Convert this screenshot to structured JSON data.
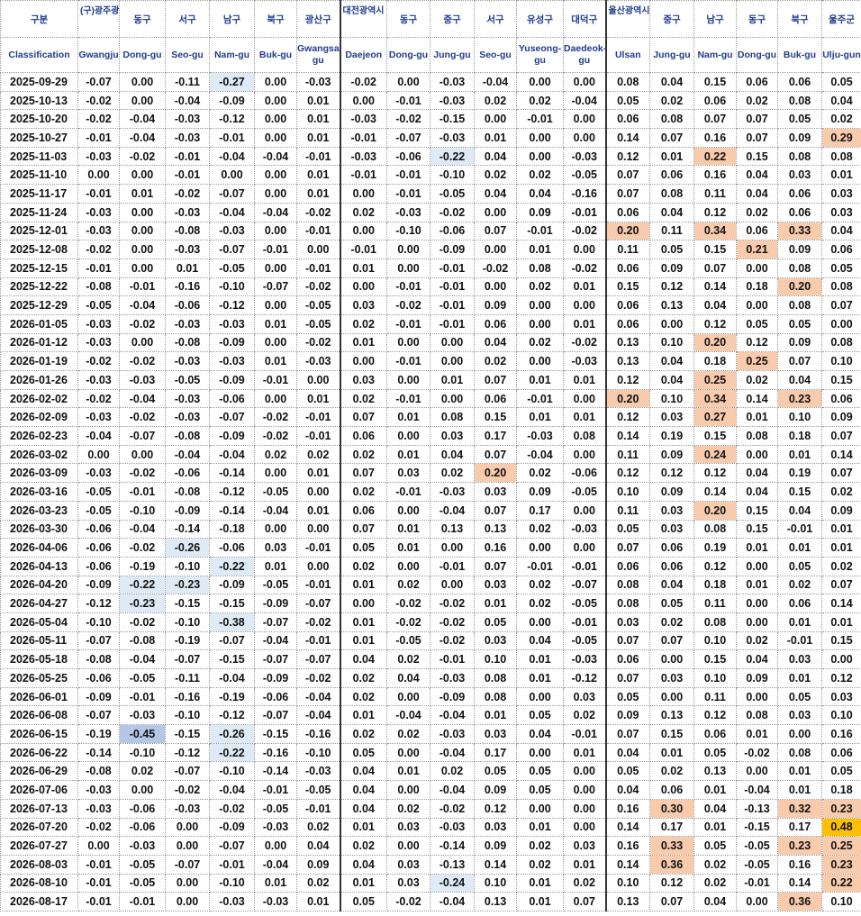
{
  "table": {
    "header_top": [
      "구분",
      "(구)광주광",
      "동구",
      "서구",
      "남구",
      "북구",
      "광산구",
      "대전광역시",
      "동구",
      "중구",
      "서구",
      "유성구",
      "대덕구",
      "울산광역시",
      "중구",
      "남구",
      "동구",
      "북구",
      "울주군"
    ],
    "header_bottom": [
      "Classification",
      "Gwangju",
      "Dong-gu",
      "Seo-gu",
      "Nam-gu",
      "Buk-gu",
      "Gwangsan-gu",
      "Daejeon",
      "Dong-gu",
      "Jung-gu",
      "Seo-gu",
      "Yuseong-gu",
      "Daedeok-gu",
      "Ulsan",
      "Jung-gu",
      "Nam-gu",
      "Dong-gu",
      "Buk-gu",
      "Ulju-gun"
    ],
    "rows": [
      {
        "date": "2025-09-29",
        "values": [
          "-0.07",
          "0.00",
          "-0.11",
          "-0.27",
          "0.00",
          "-0.03",
          "-0.02",
          "0.00",
          "-0.03",
          "-0.04",
          "0.00",
          "0.00",
          "0.08",
          "0.04",
          "0.15",
          "0.06",
          "0.06",
          "0.05"
        ]
      },
      {
        "date": "2025-10-13",
        "values": [
          "-0.02",
          "0.00",
          "-0.04",
          "-0.09",
          "0.00",
          "0.01",
          "0.00",
          "-0.01",
          "-0.03",
          "0.02",
          "0.02",
          "-0.04",
          "0.05",
          "0.02",
          "0.06",
          "0.02",
          "0.08",
          "0.04"
        ]
      },
      {
        "date": "2025-10-20",
        "values": [
          "-0.02",
          "-0.04",
          "-0.03",
          "-0.12",
          "0.00",
          "0.01",
          "-0.03",
          "-0.02",
          "-0.15",
          "0.00",
          "-0.01",
          "0.00",
          "0.06",
          "0.08",
          "0.07",
          "0.07",
          "0.05",
          "0.02"
        ]
      },
      {
        "date": "2025-10-27",
        "values": [
          "-0.01",
          "-0.04",
          "-0.03",
          "-0.01",
          "0.00",
          "0.01",
          "-0.01",
          "-0.07",
          "-0.03",
          "0.01",
          "0.00",
          "0.00",
          "0.14",
          "0.07",
          "0.16",
          "0.07",
          "0.09",
          "0.29"
        ]
      },
      {
        "date": "2025-11-03",
        "values": [
          "-0.03",
          "-0.02",
          "-0.01",
          "-0.04",
          "-0.04",
          "-0.01",
          "-0.03",
          "-0.06",
          "-0.22",
          "0.04",
          "0.00",
          "-0.03",
          "0.12",
          "0.01",
          "0.22",
          "0.15",
          "0.08",
          "0.08"
        ]
      },
      {
        "date": "2025-11-10",
        "values": [
          "0.00",
          "0.00",
          "-0.01",
          "0.00",
          "0.00",
          "0.01",
          "-0.01",
          "-0.01",
          "-0.10",
          "0.02",
          "0.02",
          "-0.05",
          "0.07",
          "0.06",
          "0.16",
          "0.04",
          "0.03",
          "0.01"
        ]
      },
      {
        "date": "2025-11-17",
        "values": [
          "-0.01",
          "0.01",
          "-0.02",
          "-0.07",
          "0.00",
          "0.01",
          "0.00",
          "-0.01",
          "-0.05",
          "0.04",
          "0.04",
          "-0.16",
          "0.07",
          "0.08",
          "0.11",
          "0.04",
          "0.06",
          "0.03"
        ]
      },
      {
        "date": "2025-11-24",
        "values": [
          "-0.03",
          "0.00",
          "-0.03",
          "-0.04",
          "-0.04",
          "-0.02",
          "0.02",
          "-0.03",
          "-0.02",
          "0.00",
          "0.09",
          "-0.01",
          "0.06",
          "0.04",
          "0.12",
          "0.02",
          "0.06",
          "0.03"
        ]
      },
      {
        "date": "2025-12-01",
        "values": [
          "-0.03",
          "0.00",
          "-0.08",
          "-0.03",
          "0.00",
          "-0.01",
          "0.00",
          "-0.10",
          "-0.06",
          "0.07",
          "-0.01",
          "-0.02",
          "0.20",
          "0.11",
          "0.34",
          "0.06",
          "0.33",
          "0.04"
        ]
      },
      {
        "date": "2025-12-08",
        "values": [
          "-0.02",
          "0.00",
          "-0.03",
          "-0.07",
          "-0.01",
          "0.00",
          "-0.01",
          "0.00",
          "-0.09",
          "0.00",
          "0.01",
          "0.00",
          "0.11",
          "0.05",
          "0.15",
          "0.21",
          "0.09",
          "0.06"
        ]
      },
      {
        "date": "2025-12-15",
        "values": [
          "-0.01",
          "0.00",
          "0.01",
          "-0.05",
          "0.00",
          "-0.01",
          "0.01",
          "0.00",
          "-0.01",
          "-0.02",
          "0.08",
          "-0.02",
          "0.06",
          "0.09",
          "0.07",
          "0.00",
          "0.08",
          "0.05"
        ]
      },
      {
        "date": "2025-12-22",
        "values": [
          "-0.08",
          "-0.01",
          "-0.16",
          "-0.10",
          "-0.07",
          "-0.02",
          "0.00",
          "-0.01",
          "-0.01",
          "0.00",
          "0.02",
          "0.01",
          "0.15",
          "0.12",
          "0.14",
          "0.18",
          "0.20",
          "0.08"
        ]
      },
      {
        "date": "2025-12-29",
        "values": [
          "-0.05",
          "-0.04",
          "-0.06",
          "-0.12",
          "0.00",
          "-0.05",
          "0.03",
          "-0.02",
          "-0.01",
          "0.09",
          "0.00",
          "0.00",
          "0.06",
          "0.13",
          "0.04",
          "0.00",
          "0.08",
          "0.07"
        ]
      },
      {
        "date": "2026-01-05",
        "values": [
          "-0.03",
          "-0.02",
          "-0.03",
          "-0.03",
          "0.01",
          "-0.05",
          "0.02",
          "-0.01",
          "-0.01",
          "0.06",
          "0.00",
          "0.01",
          "0.06",
          "0.00",
          "0.12",
          "0.05",
          "0.05",
          "0.00"
        ]
      },
      {
        "date": "2026-01-12",
        "values": [
          "-0.03",
          "0.00",
          "-0.08",
          "-0.09",
          "0.00",
          "-0.02",
          "0.01",
          "0.00",
          "0.00",
          "0.04",
          "0.02",
          "-0.02",
          "0.13",
          "0.10",
          "0.20",
          "0.12",
          "0.09",
          "0.08"
        ]
      },
      {
        "date": "2026-01-19",
        "values": [
          "-0.02",
          "-0.02",
          "-0.03",
          "-0.03",
          "0.01",
          "-0.03",
          "0.00",
          "-0.01",
          "0.00",
          "0.02",
          "0.00",
          "-0.03",
          "0.13",
          "0.04",
          "0.18",
          "0.25",
          "0.07",
          "0.10"
        ]
      },
      {
        "date": "2026-01-26",
        "values": [
          "-0.03",
          "-0.03",
          "-0.05",
          "-0.09",
          "-0.01",
          "0.00",
          "0.03",
          "0.00",
          "0.01",
          "0.07",
          "0.01",
          "0.01",
          "0.12",
          "0.04",
          "0.25",
          "0.02",
          "0.04",
          "0.15"
        ]
      },
      {
        "date": "2026-02-02",
        "values": [
          "-0.02",
          "-0.04",
          "-0.03",
          "-0.06",
          "0.00",
          "0.01",
          "0.02",
          "-0.01",
          "0.00",
          "0.06",
          "-0.01",
          "0.00",
          "0.20",
          "0.10",
          "0.34",
          "0.14",
          "0.23",
          "0.06"
        ]
      },
      {
        "date": "2026-02-09",
        "values": [
          "-0.03",
          "-0.02",
          "-0.03",
          "-0.07",
          "-0.02",
          "-0.01",
          "0.07",
          "0.01",
          "0.08",
          "0.15",
          "0.01",
          "0.01",
          "0.12",
          "0.03",
          "0.27",
          "0.01",
          "0.10",
          "0.09"
        ]
      },
      {
        "date": "2026-02-23",
        "values": [
          "-0.04",
          "-0.07",
          "-0.08",
          "-0.09",
          "-0.02",
          "-0.01",
          "0.06",
          "0.00",
          "0.03",
          "0.17",
          "-0.03",
          "0.08",
          "0.14",
          "0.19",
          "0.15",
          "0.08",
          "0.18",
          "0.07"
        ]
      },
      {
        "date": "2026-03-02",
        "values": [
          "0.00",
          "0.00",
          "-0.04",
          "-0.04",
          "0.02",
          "0.02",
          "0.02",
          "0.01",
          "0.04",
          "0.07",
          "-0.04",
          "0.00",
          "0.11",
          "0.09",
          "0.24",
          "0.00",
          "0.01",
          "0.14"
        ]
      },
      {
        "date": "2026-03-09",
        "values": [
          "-0.03",
          "-0.02",
          "-0.06",
          "-0.14",
          "0.00",
          "0.01",
          "0.07",
          "0.03",
          "0.02",
          "0.20",
          "0.02",
          "-0.06",
          "0.12",
          "0.12",
          "0.12",
          "0.04",
          "0.19",
          "0.07"
        ]
      },
      {
        "date": "2026-03-16",
        "values": [
          "-0.05",
          "-0.01",
          "-0.08",
          "-0.12",
          "-0.05",
          "0.00",
          "0.02",
          "-0.01",
          "-0.03",
          "0.03",
          "0.09",
          "-0.05",
          "0.10",
          "0.09",
          "0.14",
          "0.04",
          "0.15",
          "0.02"
        ]
      },
      {
        "date": "2026-03-23",
        "values": [
          "-0.05",
          "-0.10",
          "-0.09",
          "-0.14",
          "-0.04",
          "0.01",
          "0.06",
          "0.00",
          "-0.04",
          "0.07",
          "0.17",
          "0.00",
          "0.11",
          "0.03",
          "0.20",
          "0.15",
          "0.04",
          "0.09"
        ]
      },
      {
        "date": "2026-03-30",
        "values": [
          "-0.06",
          "-0.04",
          "-0.14",
          "-0.18",
          "0.00",
          "0.00",
          "0.07",
          "0.01",
          "0.13",
          "0.13",
          "0.02",
          "-0.03",
          "0.05",
          "0.03",
          "0.08",
          "0.15",
          "-0.01",
          "0.01"
        ]
      },
      {
        "date": "2026-04-06",
        "values": [
          "-0.06",
          "-0.02",
          "-0.26",
          "-0.06",
          "0.03",
          "-0.01",
          "0.05",
          "0.01",
          "0.00",
          "0.16",
          "0.00",
          "0.00",
          "0.07",
          "0.06",
          "0.19",
          "0.01",
          "0.01",
          "0.01"
        ]
      },
      {
        "date": "2026-04-13",
        "values": [
          "-0.06",
          "-0.19",
          "-0.10",
          "-0.22",
          "0.01",
          "0.00",
          "0.02",
          "0.00",
          "-0.01",
          "0.07",
          "-0.01",
          "-0.01",
          "0.06",
          "0.06",
          "0.12",
          "0.00",
          "0.05",
          "0.02"
        ]
      },
      {
        "date": "2026-04-20",
        "values": [
          "-0.09",
          "-0.22",
          "-0.23",
          "-0.09",
          "-0.05",
          "-0.01",
          "0.01",
          "0.02",
          "0.00",
          "0.03",
          "0.02",
          "-0.07",
          "0.08",
          "0.04",
          "0.18",
          "0.01",
          "0.02",
          "0.07"
        ]
      },
      {
        "date": "2026-04-27",
        "values": [
          "-0.12",
          "-0.23",
          "-0.15",
          "-0.15",
          "-0.09",
          "-0.07",
          "0.00",
          "-0.02",
          "-0.02",
          "0.01",
          "0.02",
          "-0.05",
          "0.08",
          "0.05",
          "0.11",
          "0.00",
          "0.06",
          "0.14"
        ]
      },
      {
        "date": "2026-05-04",
        "values": [
          "-0.10",
          "-0.02",
          "-0.10",
          "-0.38",
          "-0.07",
          "-0.02",
          "0.01",
          "-0.02",
          "-0.02",
          "0.05",
          "0.00",
          "-0.01",
          "0.03",
          "0.02",
          "0.08",
          "0.00",
          "0.01",
          "0.01"
        ]
      },
      {
        "date": "2026-05-11",
        "values": [
          "-0.07",
          "-0.08",
          "-0.19",
          "-0.07",
          "-0.04",
          "-0.01",
          "0.01",
          "-0.05",
          "-0.02",
          "0.03",
          "0.04",
          "-0.05",
          "0.07",
          "0.07",
          "0.10",
          "0.02",
          "-0.01",
          "0.15"
        ]
      },
      {
        "date": "2026-05-18",
        "values": [
          "-0.08",
          "-0.04",
          "-0.07",
          "-0.15",
          "-0.07",
          "-0.07",
          "0.04",
          "0.02",
          "-0.01",
          "0.10",
          "0.01",
          "-0.03",
          "0.06",
          "0.00",
          "0.15",
          "0.04",
          "0.03",
          "0.00"
        ]
      },
      {
        "date": "2026-05-25",
        "values": [
          "-0.06",
          "-0.05",
          "-0.11",
          "-0.04",
          "-0.09",
          "-0.02",
          "0.02",
          "0.04",
          "-0.03",
          "0.08",
          "0.01",
          "-0.12",
          "0.07",
          "0.03",
          "0.10",
          "0.09",
          "0.01",
          "0.12"
        ]
      },
      {
        "date": "2026-06-01",
        "values": [
          "-0.09",
          "-0.01",
          "-0.16",
          "-0.19",
          "-0.06",
          "-0.04",
          "0.02",
          "0.00",
          "-0.09",
          "0.08",
          "0.00",
          "0.03",
          "0.05",
          "0.00",
          "0.11",
          "0.00",
          "0.05",
          "0.03"
        ]
      },
      {
        "date": "2026-06-08",
        "values": [
          "-0.07",
          "-0.03",
          "-0.10",
          "-0.12",
          "-0.07",
          "-0.04",
          "0.01",
          "-0.04",
          "-0.04",
          "0.01",
          "0.05",
          "0.02",
          "0.09",
          "0.13",
          "0.12",
          "0.08",
          "0.03",
          "0.10"
        ]
      },
      {
        "date": "2026-06-15",
        "values": [
          "-0.19",
          "-0.45",
          "-0.15",
          "-0.26",
          "-0.15",
          "-0.16",
          "0.02",
          "0.02",
          "-0.03",
          "0.03",
          "0.04",
          "-0.01",
          "0.07",
          "0.15",
          "0.06",
          "0.01",
          "0.00",
          "0.16"
        ]
      },
      {
        "date": "2026-06-22",
        "values": [
          "-0.14",
          "-0.10",
          "-0.12",
          "-0.22",
          "-0.16",
          "-0.10",
          "0.05",
          "0.00",
          "-0.04",
          "0.17",
          "0.00",
          "0.01",
          "0.04",
          "0.01",
          "0.05",
          "-0.02",
          "0.08",
          "0.06"
        ]
      },
      {
        "date": "2026-06-29",
        "values": [
          "-0.08",
          "0.02",
          "-0.07",
          "-0.10",
          "-0.14",
          "-0.03",
          "0.04",
          "0.01",
          "0.02",
          "0.05",
          "0.05",
          "0.00",
          "0.05",
          "0.02",
          "0.13",
          "0.00",
          "0.01",
          "0.05"
        ]
      },
      {
        "date": "2026-07-06",
        "values": [
          "-0.03",
          "0.00",
          "-0.02",
          "-0.04",
          "-0.01",
          "-0.05",
          "0.04",
          "0.00",
          "-0.04",
          "0.09",
          "0.05",
          "0.00",
          "0.04",
          "0.06",
          "0.01",
          "-0.04",
          "0.01",
          "0.18"
        ]
      },
      {
        "date": "2026-07-13",
        "values": [
          "-0.03",
          "-0.06",
          "-0.03",
          "-0.02",
          "-0.05",
          "-0.01",
          "0.04",
          "0.02",
          "-0.02",
          "0.12",
          "0.00",
          "0.00",
          "0.16",
          "0.30",
          "0.04",
          "-0.13",
          "0.32",
          "0.23"
        ]
      },
      {
        "date": "2026-07-20",
        "values": [
          "-0.02",
          "-0.06",
          "0.00",
          "-0.09",
          "-0.03",
          "0.02",
          "0.01",
          "0.03",
          "-0.03",
          "0.03",
          "0.01",
          "0.00",
          "0.14",
          "0.17",
          "0.01",
          "-0.15",
          "0.17",
          "0.48"
        ]
      },
      {
        "date": "2026-07-27",
        "values": [
          "0.00",
          "-0.03",
          "0.00",
          "-0.07",
          "0.00",
          "0.04",
          "0.02",
          "0.00",
          "-0.14",
          "0.09",
          "0.02",
          "0.03",
          "0.16",
          "0.33",
          "0.05",
          "-0.05",
          "0.23",
          "0.25"
        ]
      },
      {
        "date": "2026-08-03",
        "values": [
          "-0.01",
          "-0.05",
          "-0.07",
          "-0.01",
          "-0.04",
          "0.09",
          "0.04",
          "0.03",
          "-0.13",
          "0.14",
          "0.02",
          "0.01",
          "0.14",
          "0.36",
          "0.02",
          "-0.05",
          "0.16",
          "0.23"
        ]
      },
      {
        "date": "2026-08-10",
        "values": [
          "-0.01",
          "-0.05",
          "0.00",
          "-0.10",
          "0.01",
          "0.02",
          "0.01",
          "0.03",
          "-0.24",
          "0.10",
          "0.01",
          "0.02",
          "0.10",
          "0.12",
          "0.02",
          "-0.01",
          "0.14",
          "0.22"
        ]
      },
      {
        "date": "2026-08-17",
        "values": [
          "-0.01",
          "-0.01",
          "0.00",
          "-0.03",
          "-0.03",
          "0.01",
          "0.05",
          "-0.02",
          "-0.04",
          "0.13",
          "0.01",
          "0.07",
          "0.13",
          "0.07",
          "0.04",
          "0.00",
          "0.36",
          "0.10"
        ]
      }
    ]
  },
  "highlight_colors": {
    "light_blue": "#deebf7",
    "blue": "#b4c7e7",
    "light_orange": "#f8cbad",
    "gold": "#ffc000"
  }
}
